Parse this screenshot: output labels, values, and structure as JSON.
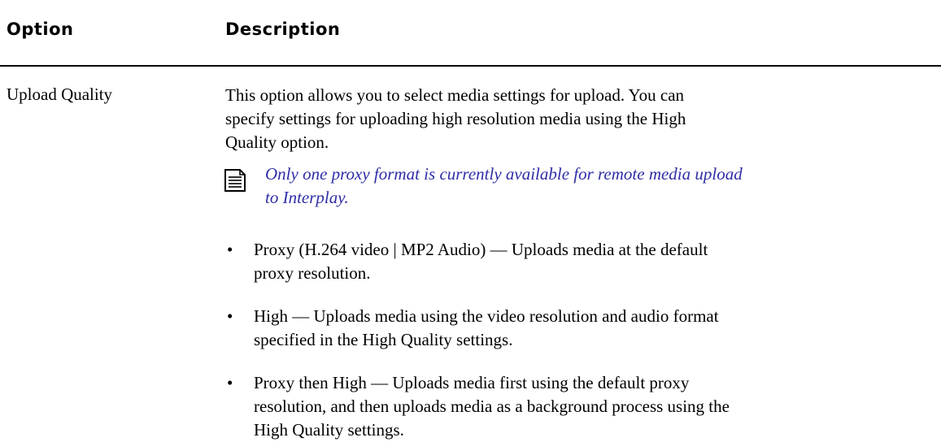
{
  "table": {
    "headers": {
      "option": "Option",
      "description": "Description"
    },
    "rows": [
      {
        "option": "Upload Quality",
        "intro": "This option allows you to select media settings for upload. You can specify settings for uploading high resolution media using the High Quality option.",
        "note_icon": "note-icon",
        "note": "Only one proxy format is currently available for remote media upload to Interplay.",
        "bullets": [
          "Proxy (H.264 video | MP2 Audio) — Uploads media at the default proxy resolution.",
          "High — Uploads media using the video resolution and audio format specified in the High Quality settings.",
          "Proxy then High — Uploads media first using the default proxy resolution, and then uploads media as a background process using the High Quality settings."
        ]
      }
    ]
  },
  "colors": {
    "note_text": "#2e2da6",
    "text": "#000000",
    "rule": "#000000"
  }
}
